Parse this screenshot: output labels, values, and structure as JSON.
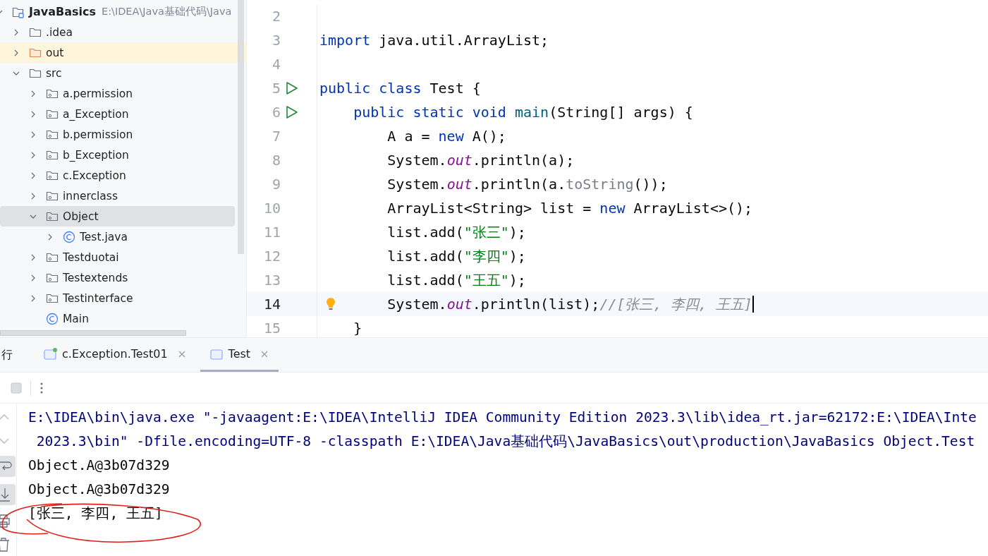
{
  "project": {
    "name": "JavaBasics",
    "path": "E:\\IDEA\\Java基础代码\\Java",
    "expanded": true,
    "children": [
      {
        "label": ".idea",
        "kind": "folder",
        "expanded": false,
        "selected": false
      },
      {
        "label": "out",
        "kind": "excluded-folder",
        "expanded": false,
        "selected": false
      },
      {
        "label": "src",
        "kind": "folder",
        "expanded": true,
        "selected": false,
        "children": [
          {
            "label": "a.permission",
            "kind": "package",
            "expanded": false,
            "selected": false
          },
          {
            "label": "a_Exception",
            "kind": "package",
            "expanded": false,
            "selected": false
          },
          {
            "label": "b.permission",
            "kind": "package",
            "expanded": false,
            "selected": false
          },
          {
            "label": "b_Exception",
            "kind": "package",
            "expanded": false,
            "selected": false
          },
          {
            "label": "c.Exception",
            "kind": "package",
            "expanded": false,
            "selected": false
          },
          {
            "label": "innerclass",
            "kind": "package",
            "expanded": false,
            "selected": false
          },
          {
            "label": "Object",
            "kind": "package",
            "expanded": true,
            "selected": true,
            "children": [
              {
                "label": "Test.java",
                "kind": "class",
                "expanded": false,
                "selected": false
              }
            ]
          },
          {
            "label": "Testduotai",
            "kind": "package",
            "expanded": false,
            "selected": false
          },
          {
            "label": "Testextends",
            "kind": "package",
            "expanded": false,
            "selected": false
          },
          {
            "label": "Testinterface",
            "kind": "package",
            "expanded": false,
            "selected": false
          },
          {
            "label": "Main",
            "kind": "class-file",
            "selected": false
          }
        ]
      }
    ]
  },
  "editor": {
    "lines": [
      {
        "number": "2",
        "run": false,
        "current": false,
        "bulb": false
      },
      {
        "number": "3",
        "run": false,
        "current": false,
        "bulb": false,
        "tokens": [
          {
            "text": "import",
            "kind": "keyword"
          },
          {
            "text": " java.util.ArrayList;",
            "kind": "plain"
          }
        ]
      },
      {
        "number": "4",
        "run": false,
        "current": false,
        "bulb": false
      },
      {
        "number": "5",
        "run": true,
        "current": false,
        "bulb": false,
        "tokens": [
          {
            "text": "public class",
            "kind": "keyword"
          },
          {
            "text": " Test {",
            "kind": "plain"
          }
        ]
      },
      {
        "number": "6",
        "run": true,
        "current": false,
        "bulb": false,
        "tokens": [
          {
            "text": "    public static void",
            "kind": "keyword"
          },
          {
            "text": " main",
            "kind": "method"
          },
          {
            "text": "(String[] args) {",
            "kind": "plain"
          }
        ]
      },
      {
        "number": "7",
        "run": false,
        "current": false,
        "bulb": false,
        "tokens": [
          {
            "text": "        A a = ",
            "kind": "plain"
          },
          {
            "text": "new",
            "kind": "keyword"
          },
          {
            "text": " A();",
            "kind": "plain"
          }
        ]
      },
      {
        "number": "8",
        "run": false,
        "current": false,
        "bulb": false,
        "tokens": [
          {
            "text": "        System.",
            "kind": "plain"
          },
          {
            "text": "out",
            "kind": "field"
          },
          {
            "text": ".println(a);",
            "kind": "plain"
          }
        ]
      },
      {
        "number": "9",
        "run": false,
        "current": false,
        "bulb": false,
        "tokens": [
          {
            "text": "        System.",
            "kind": "plain"
          },
          {
            "text": "out",
            "kind": "field"
          },
          {
            "text": ".println(a.",
            "kind": "plain"
          },
          {
            "text": "toString",
            "kind": "dim"
          },
          {
            "text": "());",
            "kind": "plain"
          }
        ]
      },
      {
        "number": "10",
        "run": false,
        "current": false,
        "bulb": false,
        "tokens": [
          {
            "text": "        ArrayList<String> list = ",
            "kind": "plain"
          },
          {
            "text": "new",
            "kind": "keyword"
          },
          {
            "text": " ArrayList<>();",
            "kind": "plain"
          }
        ]
      },
      {
        "number": "11",
        "run": false,
        "current": false,
        "bulb": false,
        "tokens": [
          {
            "text": "        list.add(",
            "kind": "plain"
          },
          {
            "text": "\"张三\"",
            "kind": "string"
          },
          {
            "text": ");",
            "kind": "plain"
          }
        ]
      },
      {
        "number": "12",
        "run": false,
        "current": false,
        "bulb": false,
        "tokens": [
          {
            "text": "        list.add(",
            "kind": "plain"
          },
          {
            "text": "\"李四\"",
            "kind": "string"
          },
          {
            "text": ");",
            "kind": "plain"
          }
        ]
      },
      {
        "number": "13",
        "run": false,
        "current": false,
        "bulb": false,
        "tokens": [
          {
            "text": "        list.add(",
            "kind": "plain"
          },
          {
            "text": "\"王五\"",
            "kind": "string"
          },
          {
            "text": ");",
            "kind": "plain"
          }
        ]
      },
      {
        "number": "14",
        "run": false,
        "current": true,
        "bulb": true,
        "tokens": [
          {
            "text": "        System.",
            "kind": "plain"
          },
          {
            "text": "out",
            "kind": "field"
          },
          {
            "text": ".println(list);",
            "kind": "plain"
          },
          {
            "text": "//[张三, 李四, 王五]",
            "kind": "comment"
          }
        ]
      },
      {
        "number": "15",
        "run": false,
        "current": false,
        "bulb": false,
        "tokens": [
          {
            "text": "    }",
            "kind": "plain"
          }
        ]
      }
    ]
  },
  "run_panel": {
    "title": "行",
    "tabs": [
      {
        "label": "c.Exception.Test01",
        "selected": false,
        "running": true
      },
      {
        "label": "Test",
        "selected": true,
        "running": false
      }
    ],
    "console": [
      {
        "text": "E:\\IDEA\\bin\\java.exe \"-javaagent:E:\\IDEA\\IntelliJ IDEA Community Edition 2023.3\\lib\\idea_rt.jar=62172:E:\\IDEA\\Inte",
        "kind": "command"
      },
      {
        "text": " 2023.3\\bin\" -Dfile.encoding=UTF-8 -classpath E:\\IDEA\\Java基础代码\\JavaBasics\\out\\production\\JavaBasics Object.Test",
        "kind": "command"
      },
      {
        "text": "Object.A@3b07d329",
        "kind": "output"
      },
      {
        "text": "Object.A@3b07d329",
        "kind": "output"
      },
      {
        "text": "[张三, 李四, 王五]",
        "kind": "output"
      }
    ]
  }
}
